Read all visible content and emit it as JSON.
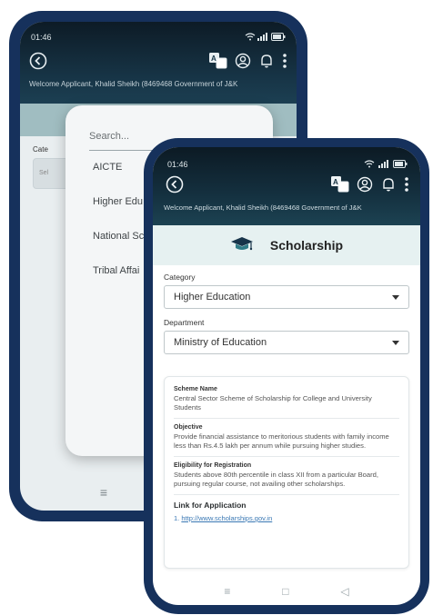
{
  "back_screen": {
    "status_time": "01:46",
    "welcome_text": "Welcome Applicant, Khalid Sheikh (8469468 Government of J&K",
    "category_label": "Cate",
    "field_placeholder": "Sel",
    "dialog": {
      "search_placeholder": "Search...",
      "options": [
        "AICTE",
        "Higher Edu",
        "National Sc",
        "Tribal Affai"
      ]
    },
    "nav_menu_glyph": "≡"
  },
  "front_screen": {
    "status_time": "01:46",
    "welcome_text": "Welcome Applicant, Khalid Sheikh (8469468 Government of J&K",
    "banner_title": "Scholarship",
    "category_label": "Category",
    "category_value": "Higher Education",
    "department_label": "Department",
    "department_value": "Ministry of Education",
    "card": {
      "scheme_heading": "Scheme Name",
      "scheme_text": "Central Sector Scheme of Scholarship for College and University Students",
      "objective_heading": "Objective",
      "objective_text": "Provide financial assistance to meritorious students with family income less than Rs.4.5 lakh per annum while pursuing higher studies.",
      "eligibility_heading": "Eligibility for Registration",
      "eligibility_text": "Students above 80th percentile in class XII from a particular Board, pursuing regular course, not availing other scholarships.",
      "link_heading": "Link for Application",
      "link_number": "1.",
      "link_url": "http://www.scholarships.gov.in"
    },
    "nav": {
      "menu_glyph": "≡",
      "home_glyph": "□",
      "back_glyph": "◁"
    }
  },
  "colors": {
    "phone_frame": "#16315c",
    "header_dark": "#0c1a24",
    "banner_bg": "#e6f1f1",
    "link": "#3a78b4"
  },
  "icons": [
    "back-circle-icon",
    "translate-icon",
    "account-icon",
    "notification-icon",
    "more-vert-icon",
    "graduation-cap-icon",
    "dropdown-caret-icon",
    "wifi-icon",
    "signal-icon",
    "battery-icon"
  ]
}
